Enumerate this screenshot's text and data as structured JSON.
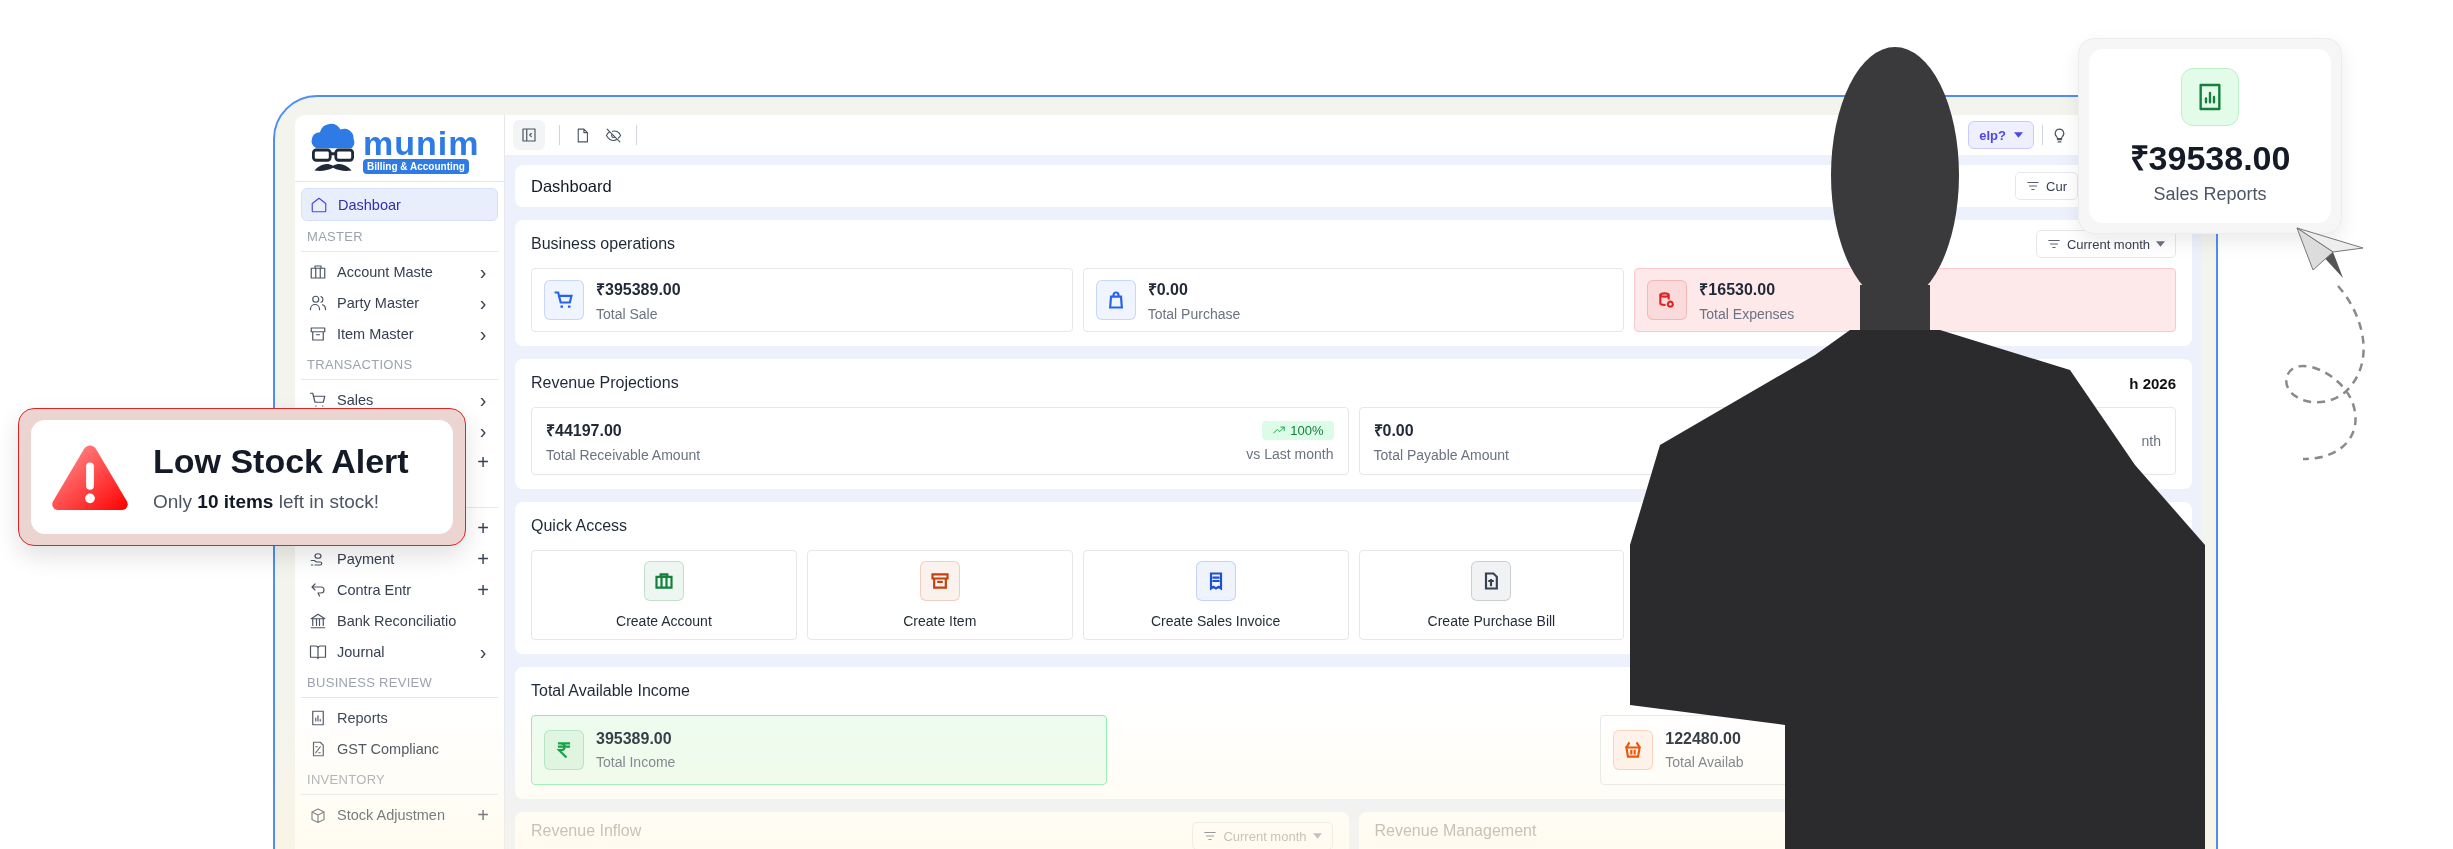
{
  "sidebar": {
    "logo": {
      "name": "munim",
      "tagline": "Billing & Accounting"
    },
    "items": [
      {
        "kind": "link",
        "label": "Dashboar",
        "selected": true
      },
      {
        "kind": "section",
        "label": "MASTER"
      },
      {
        "kind": "link",
        "label": "Account Maste",
        "selected": false,
        "action": "›"
      },
      {
        "kind": "link",
        "label": "Party Master",
        "selected": false,
        "action": "›"
      },
      {
        "kind": "link",
        "label": "Item Master",
        "selected": false,
        "action": "›"
      },
      {
        "kind": "section",
        "label": "TRANSACTIONS"
      },
      {
        "kind": "link",
        "label": "Sales",
        "selected": false,
        "action": "›"
      },
      {
        "kind": "link",
        "action": "›"
      },
      {
        "kind": "link",
        "action": "+"
      },
      {
        "kind": "section"
      },
      {
        "kind": "link",
        "action": "+"
      },
      {
        "kind": "link",
        "label": "Payment",
        "selected": false,
        "action": "+"
      },
      {
        "kind": "link",
        "label": "Contra Entr",
        "selected": false,
        "action": "+"
      },
      {
        "kind": "link",
        "label": "Bank Reconciliatio",
        "selected": false
      },
      {
        "kind": "link",
        "label": "Journal",
        "selected": false,
        "action": "›"
      },
      {
        "kind": "section",
        "label": "BUSINESS REVIEW"
      },
      {
        "kind": "link",
        "label": "Reports",
        "selected": false
      },
      {
        "kind": "link",
        "label": "GST Complianc",
        "selected": false
      },
      {
        "kind": "section",
        "label": "INVENTORY"
      },
      {
        "kind": "link",
        "label": "Stock Adjustmen",
        "selected": false,
        "action": "+"
      }
    ]
  },
  "topbar": {
    "help": "elp?"
  },
  "dashboard": {
    "title": "Dashboard",
    "filter": "Cur"
  },
  "business_operations": {
    "title": "Business operations",
    "filter": "Current month",
    "cards": [
      {
        "value": "₹395389.00",
        "label": "Total Sale",
        "color": "#2563eb",
        "highlight": false
      },
      {
        "value": "₹0.00",
        "label": "Total Purchase",
        "color": "#2563eb",
        "highlight": false
      },
      {
        "value": "₹16530.00",
        "label": "Total Expenses",
        "color": "#dc2626",
        "highlight": true
      }
    ]
  },
  "revenue_projections": {
    "title": "Revenue Projections",
    "period": "h 2026",
    "cards": [
      {
        "value": "₹44197.00",
        "label": "Total Receivable Amount",
        "badge": "100%",
        "sub": "vs Last month"
      },
      {
        "value": "₹0.00",
        "label": "Total Payable Amount",
        "sub": "nth"
      }
    ]
  },
  "quick_access": {
    "title": "Quick Access",
    "tiles": [
      {
        "label": "Create Account",
        "color": "#15803d"
      },
      {
        "label": "Create Item",
        "color": "#c2410c"
      },
      {
        "label": "Create Sales Invoice",
        "color": "#1d4ed8"
      },
      {
        "label": "Create Purchase Bill",
        "color": "#374151"
      }
    ]
  },
  "total_available_income": {
    "title": "Total Available Income",
    "cards": [
      {
        "value": "395389.00",
        "label": "Total Income",
        "color": "#16a34a",
        "highlight": true
      },
      {
        "value": "122480.00",
        "label": "Total Availab",
        "color": "#ea580c",
        "highlight": false
      }
    ]
  },
  "panels": [
    {
      "title": "Revenue Inflow",
      "filter": "Current month"
    },
    {
      "title": "Revenue Management"
    }
  ],
  "alert": {
    "title": "Low Stock Alert",
    "message": "Only **10 items** left in stock!"
  },
  "sales_report": {
    "amount": "₹39538.00",
    "label": "Sales Reports"
  }
}
